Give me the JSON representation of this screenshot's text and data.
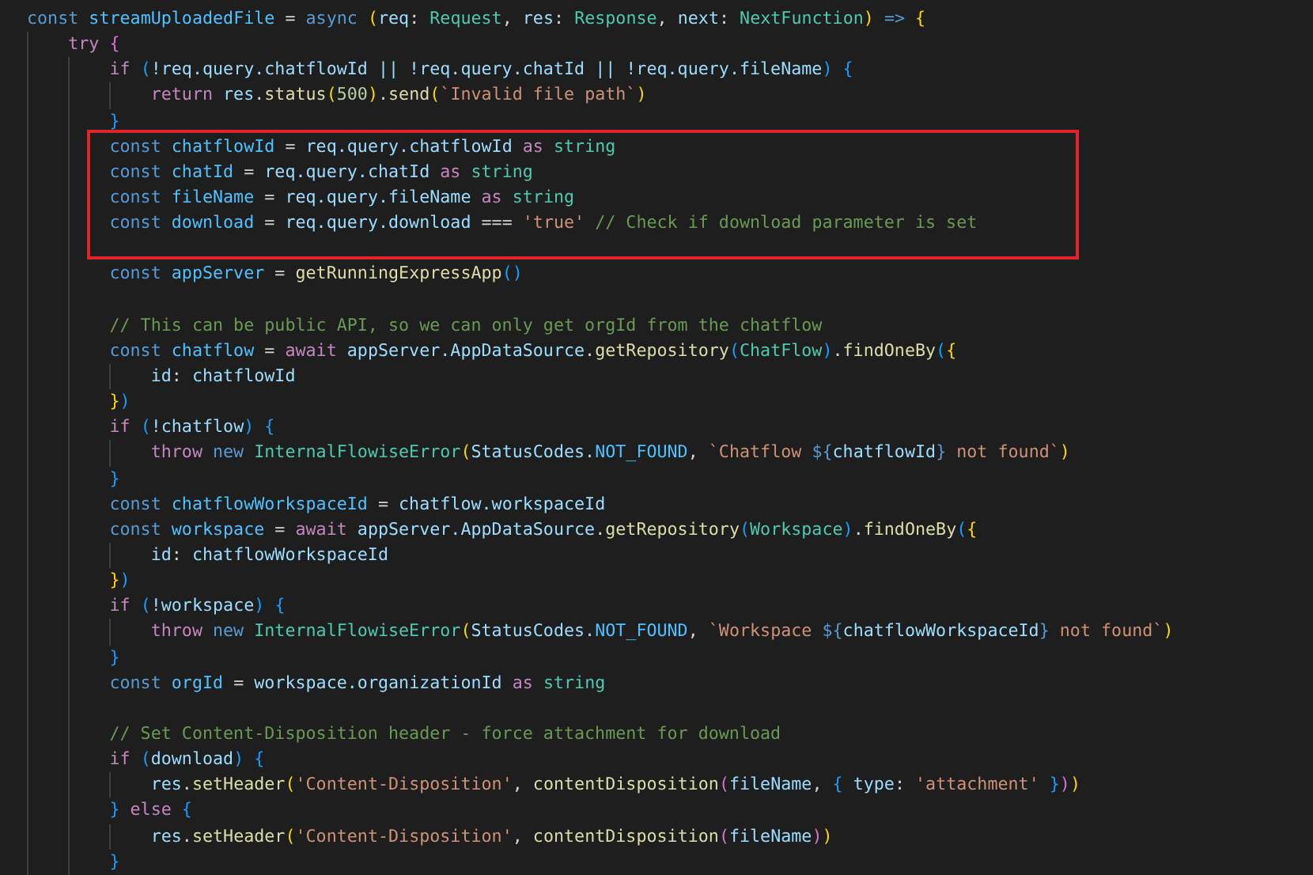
{
  "editor": {
    "lines": [
      {
        "kind": "code",
        "tokens": [
          {
            "text": "const ",
            "kind": "keyword"
          },
          {
            "text": "streamUploadedFile",
            "kind": "constant"
          },
          {
            "text": " = ",
            "kind": "plain"
          },
          {
            "text": "async ",
            "kind": "keyword"
          },
          {
            "text": "(",
            "kind": "bracket1"
          },
          {
            "text": "req",
            "kind": "variable"
          },
          {
            "text": ": ",
            "kind": "plain"
          },
          {
            "text": "Request",
            "kind": "type"
          },
          {
            "text": ", ",
            "kind": "plain"
          },
          {
            "text": "res",
            "kind": "variable"
          },
          {
            "text": ": ",
            "kind": "plain"
          },
          {
            "text": "Response",
            "kind": "type"
          },
          {
            "text": ", ",
            "kind": "plain"
          },
          {
            "text": "next",
            "kind": "variable"
          },
          {
            "text": ": ",
            "kind": "plain"
          },
          {
            "text": "NextFunction",
            "kind": "type"
          },
          {
            "text": ")",
            "kind": "bracket1"
          },
          {
            "text": " => ",
            "kind": "keyword"
          },
          {
            "text": "{",
            "kind": "bracket1"
          }
        ],
        "children": [
          {
            "kind": "code",
            "tokens": [
              {
                "text": "try ",
                "kind": "control"
              },
              {
                "text": "{",
                "kind": "bracket2"
              }
            ],
            "children": [
              {
                "kind": "code",
                "tokens": [
                  {
                    "text": "if ",
                    "kind": "control"
                  },
                  {
                    "text": "(",
                    "kind": "bracket3"
                  },
                  {
                    "text": "!req.query.chatflowId || !req.query.chatId || !req.query.fileName",
                    "kind": "variable"
                  },
                  {
                    "text": ") {",
                    "kind": "bracket3"
                  }
                ],
                "children": [
                  {
                    "kind": "code",
                    "tokens": [
                      {
                        "text": "return ",
                        "kind": "control"
                      },
                      {
                        "text": "res",
                        "kind": "variable"
                      },
                      {
                        "text": ".",
                        "kind": "plain"
                      },
                      {
                        "text": "status",
                        "kind": "function"
                      },
                      {
                        "text": "(",
                        "kind": "bracket1"
                      },
                      {
                        "text": "500",
                        "kind": "number"
                      },
                      {
                        "text": ")",
                        "kind": "bracket1"
                      },
                      {
                        "text": ".",
                        "kind": "plain"
                      },
                      {
                        "text": "send",
                        "kind": "function"
                      },
                      {
                        "text": "(",
                        "kind": "bracket1"
                      },
                      {
                        "text": "`Invalid file path`",
                        "kind": "string"
                      },
                      {
                        "text": ")",
                        "kind": "bracket1"
                      }
                    ]
                  }
                ]
              },
              {
                "kind": "code",
                "tokens": [
                  {
                    "text": "}",
                    "kind": "bracket3"
                  }
                ]
              },
              {
                "kind": "code",
                "tokens": [
                  {
                    "text": "const ",
                    "kind": "keyword"
                  },
                  {
                    "text": "chatflowId",
                    "kind": "constant"
                  },
                  {
                    "text": " = ",
                    "kind": "plain"
                  },
                  {
                    "text": "req.query.chatflowId",
                    "kind": "variable"
                  },
                  {
                    "text": " as ",
                    "kind": "control"
                  },
                  {
                    "text": "string",
                    "kind": "type"
                  }
                ]
              },
              {
                "kind": "code",
                "tokens": [
                  {
                    "text": "const ",
                    "kind": "keyword"
                  },
                  {
                    "text": "chatId",
                    "kind": "constant"
                  },
                  {
                    "text": " = ",
                    "kind": "plain"
                  },
                  {
                    "text": "req.query.chatId",
                    "kind": "variable"
                  },
                  {
                    "text": " as ",
                    "kind": "control"
                  },
                  {
                    "text": "string",
                    "kind": "type"
                  }
                ]
              },
              {
                "kind": "code",
                "tokens": [
                  {
                    "text": "const ",
                    "kind": "keyword"
                  },
                  {
                    "text": "fileName",
                    "kind": "constant"
                  },
                  {
                    "text": " = ",
                    "kind": "plain"
                  },
                  {
                    "text": "req.query.fileName",
                    "kind": "variable"
                  },
                  {
                    "text": " as ",
                    "kind": "control"
                  },
                  {
                    "text": "string",
                    "kind": "type"
                  }
                ]
              },
              {
                "kind": "code",
                "tokens": [
                  {
                    "text": "const ",
                    "kind": "keyword"
                  },
                  {
                    "text": "download",
                    "kind": "constant"
                  },
                  {
                    "text": " = ",
                    "kind": "plain"
                  },
                  {
                    "text": "req.query.download",
                    "kind": "variable"
                  },
                  {
                    "text": " === ",
                    "kind": "plain"
                  },
                  {
                    "text": "'true' ",
                    "kind": "string"
                  },
                  {
                    "text": "// Check if download parameter is set",
                    "kind": "comment"
                  }
                ]
              },
              {
                "kind": "blank"
              },
              {
                "kind": "code",
                "tokens": [
                  {
                    "text": "const ",
                    "kind": "keyword"
                  },
                  {
                    "text": "appServer",
                    "kind": "constant"
                  },
                  {
                    "text": " = ",
                    "kind": "plain"
                  },
                  {
                    "text": "getRunningExpressApp",
                    "kind": "function"
                  },
                  {
                    "text": "()",
                    "kind": "bracket3"
                  }
                ]
              },
              {
                "kind": "blank"
              },
              {
                "kind": "code",
                "tokens": [
                  {
                    "text": "// This can be public API, so we can only get orgId from the chatflow",
                    "kind": "comment"
                  }
                ]
              },
              {
                "kind": "code",
                "tokens": [
                  {
                    "text": "const ",
                    "kind": "keyword"
                  },
                  {
                    "text": "chatflow",
                    "kind": "constant"
                  },
                  {
                    "text": " = ",
                    "kind": "plain"
                  },
                  {
                    "text": "await ",
                    "kind": "control"
                  },
                  {
                    "text": "appServer.AppDataSource",
                    "kind": "variable"
                  },
                  {
                    "text": ".",
                    "kind": "plain"
                  },
                  {
                    "text": "getRepository",
                    "kind": "function"
                  },
                  {
                    "text": "(",
                    "kind": "bracket3"
                  },
                  {
                    "text": "ChatFlow",
                    "kind": "type"
                  },
                  {
                    "text": ")",
                    "kind": "bracket3"
                  },
                  {
                    "text": ".",
                    "kind": "plain"
                  },
                  {
                    "text": "findOneBy",
                    "kind": "function"
                  },
                  {
                    "text": "(",
                    "kind": "bracket3"
                  },
                  {
                    "text": "{",
                    "kind": "bracket1"
                  }
                ],
                "children": [
                  {
                    "kind": "code",
                    "tokens": [
                      {
                        "text": "id",
                        "kind": "variable"
                      },
                      {
                        "text": ": ",
                        "kind": "plain"
                      },
                      {
                        "text": "chatflowId",
                        "kind": "variable"
                      }
                    ]
                  }
                ]
              },
              {
                "kind": "code",
                "tokens": [
                  {
                    "text": "}",
                    "kind": "bracket1"
                  },
                  {
                    "text": ")",
                    "kind": "bracket3"
                  }
                ]
              },
              {
                "kind": "code",
                "tokens": [
                  {
                    "text": "if ",
                    "kind": "control"
                  },
                  {
                    "text": "(",
                    "kind": "bracket3"
                  },
                  {
                    "text": "!chatflow",
                    "kind": "variable"
                  },
                  {
                    "text": ") {",
                    "kind": "bracket3"
                  }
                ],
                "children": [
                  {
                    "kind": "code",
                    "tokens": [
                      {
                        "text": "throw ",
                        "kind": "control"
                      },
                      {
                        "text": "new ",
                        "kind": "keyword"
                      },
                      {
                        "text": "InternalFlowiseError",
                        "kind": "type"
                      },
                      {
                        "text": "(",
                        "kind": "bracket1"
                      },
                      {
                        "text": "StatusCodes.",
                        "kind": "variable"
                      },
                      {
                        "text": "NOT_FOUND",
                        "kind": "constant"
                      },
                      {
                        "text": ", ",
                        "kind": "plain"
                      },
                      {
                        "text": "`Chatflow ",
                        "kind": "string"
                      },
                      {
                        "text": "${",
                        "kind": "keyword"
                      },
                      {
                        "text": "chatflowId",
                        "kind": "variable"
                      },
                      {
                        "text": "}",
                        "kind": "keyword"
                      },
                      {
                        "text": " not found`",
                        "kind": "string"
                      },
                      {
                        "text": ")",
                        "kind": "bracket1"
                      }
                    ]
                  }
                ]
              },
              {
                "kind": "code",
                "tokens": [
                  {
                    "text": "}",
                    "kind": "bracket3"
                  }
                ]
              },
              {
                "kind": "code",
                "tokens": [
                  {
                    "text": "const ",
                    "kind": "keyword"
                  },
                  {
                    "text": "chatflowWorkspaceId",
                    "kind": "constant"
                  },
                  {
                    "text": " = ",
                    "kind": "plain"
                  },
                  {
                    "text": "chatflow.workspaceId",
                    "kind": "variable"
                  }
                ]
              },
              {
                "kind": "code",
                "tokens": [
                  {
                    "text": "const ",
                    "kind": "keyword"
                  },
                  {
                    "text": "workspace",
                    "kind": "constant"
                  },
                  {
                    "text": " = ",
                    "kind": "plain"
                  },
                  {
                    "text": "await ",
                    "kind": "control"
                  },
                  {
                    "text": "appServer.AppDataSource",
                    "kind": "variable"
                  },
                  {
                    "text": ".",
                    "kind": "plain"
                  },
                  {
                    "text": "getRepository",
                    "kind": "function"
                  },
                  {
                    "text": "(",
                    "kind": "bracket3"
                  },
                  {
                    "text": "Workspace",
                    "kind": "type"
                  },
                  {
                    "text": ")",
                    "kind": "bracket3"
                  },
                  {
                    "text": ".",
                    "kind": "plain"
                  },
                  {
                    "text": "findOneBy",
                    "kind": "function"
                  },
                  {
                    "text": "(",
                    "kind": "bracket3"
                  },
                  {
                    "text": "{",
                    "kind": "bracket1"
                  }
                ],
                "children": [
                  {
                    "kind": "code",
                    "tokens": [
                      {
                        "text": "id",
                        "kind": "variable"
                      },
                      {
                        "text": ": ",
                        "kind": "plain"
                      },
                      {
                        "text": "chatflowWorkspaceId",
                        "kind": "variable"
                      }
                    ]
                  }
                ]
              },
              {
                "kind": "code",
                "tokens": [
                  {
                    "text": "}",
                    "kind": "bracket1"
                  },
                  {
                    "text": ")",
                    "kind": "bracket3"
                  }
                ]
              },
              {
                "kind": "code",
                "tokens": [
                  {
                    "text": "if ",
                    "kind": "control"
                  },
                  {
                    "text": "(",
                    "kind": "bracket3"
                  },
                  {
                    "text": "!workspace",
                    "kind": "variable"
                  },
                  {
                    "text": ") {",
                    "kind": "bracket3"
                  }
                ],
                "children": [
                  {
                    "kind": "code",
                    "tokens": [
                      {
                        "text": "throw ",
                        "kind": "control"
                      },
                      {
                        "text": "new ",
                        "kind": "keyword"
                      },
                      {
                        "text": "InternalFlowiseError",
                        "kind": "type"
                      },
                      {
                        "text": "(",
                        "kind": "bracket1"
                      },
                      {
                        "text": "StatusCodes.",
                        "kind": "variable"
                      },
                      {
                        "text": "NOT_FOUND",
                        "kind": "constant"
                      },
                      {
                        "text": ", ",
                        "kind": "plain"
                      },
                      {
                        "text": "`Workspace ",
                        "kind": "string"
                      },
                      {
                        "text": "${",
                        "kind": "keyword"
                      },
                      {
                        "text": "chatflowWorkspaceId",
                        "kind": "variable"
                      },
                      {
                        "text": "}",
                        "kind": "keyword"
                      },
                      {
                        "text": " not found`",
                        "kind": "string"
                      },
                      {
                        "text": ")",
                        "kind": "bracket1"
                      }
                    ]
                  }
                ]
              },
              {
                "kind": "code",
                "tokens": [
                  {
                    "text": "}",
                    "kind": "bracket3"
                  }
                ]
              },
              {
                "kind": "code",
                "tokens": [
                  {
                    "text": "const ",
                    "kind": "keyword"
                  },
                  {
                    "text": "orgId",
                    "kind": "constant"
                  },
                  {
                    "text": " = ",
                    "kind": "plain"
                  },
                  {
                    "text": "workspace.organizationId",
                    "kind": "variable"
                  },
                  {
                    "text": " as ",
                    "kind": "control"
                  },
                  {
                    "text": "string",
                    "kind": "type"
                  }
                ]
              },
              {
                "kind": "blank"
              },
              {
                "kind": "code",
                "tokens": [
                  {
                    "text": "// Set Content-Disposition header - force attachment for download",
                    "kind": "comment"
                  }
                ]
              },
              {
                "kind": "code",
                "tokens": [
                  {
                    "text": "if ",
                    "kind": "control"
                  },
                  {
                    "text": "(",
                    "kind": "bracket3"
                  },
                  {
                    "text": "download",
                    "kind": "variable"
                  },
                  {
                    "text": ") {",
                    "kind": "bracket3"
                  }
                ],
                "children": [
                  {
                    "kind": "code",
                    "tokens": [
                      {
                        "text": "res",
                        "kind": "variable"
                      },
                      {
                        "text": ".",
                        "kind": "plain"
                      },
                      {
                        "text": "setHeader",
                        "kind": "function"
                      },
                      {
                        "text": "(",
                        "kind": "bracket1"
                      },
                      {
                        "text": "'Content-Disposition'",
                        "kind": "string"
                      },
                      {
                        "text": ", ",
                        "kind": "plain"
                      },
                      {
                        "text": "contentDisposition",
                        "kind": "function"
                      },
                      {
                        "text": "(",
                        "kind": "bracket2"
                      },
                      {
                        "text": "fileName",
                        "kind": "variable"
                      },
                      {
                        "text": ", ",
                        "kind": "plain"
                      },
                      {
                        "text": "{",
                        "kind": "bracket3"
                      },
                      {
                        "text": " type",
                        "kind": "variable"
                      },
                      {
                        "text": ": ",
                        "kind": "plain"
                      },
                      {
                        "text": "'attachment'",
                        "kind": "string"
                      },
                      {
                        "text": " }",
                        "kind": "bracket3"
                      },
                      {
                        "text": ")",
                        "kind": "bracket2"
                      },
                      {
                        "text": ")",
                        "kind": "bracket1"
                      }
                    ]
                  }
                ]
              },
              {
                "kind": "code",
                "tokens": [
                  {
                    "text": "}",
                    "kind": "bracket3"
                  },
                  {
                    "text": " else ",
                    "kind": "control"
                  },
                  {
                    "text": "{",
                    "kind": "bracket3"
                  }
                ],
                "children": [
                  {
                    "kind": "code",
                    "tokens": [
                      {
                        "text": "res",
                        "kind": "variable"
                      },
                      {
                        "text": ".",
                        "kind": "plain"
                      },
                      {
                        "text": "setHeader",
                        "kind": "function"
                      },
                      {
                        "text": "(",
                        "kind": "bracket1"
                      },
                      {
                        "text": "'Content-Disposition'",
                        "kind": "string"
                      },
                      {
                        "text": ", ",
                        "kind": "plain"
                      },
                      {
                        "text": "contentDisposition",
                        "kind": "function"
                      },
                      {
                        "text": "(",
                        "kind": "bracket2"
                      },
                      {
                        "text": "fileName",
                        "kind": "variable"
                      },
                      {
                        "text": ")",
                        "kind": "bracket2"
                      },
                      {
                        "text": ")",
                        "kind": "bracket1"
                      }
                    ]
                  }
                ]
              },
              {
                "kind": "code",
                "tokens": [
                  {
                    "text": "}",
                    "kind": "bracket3"
                  }
                ]
              }
            ]
          }
        ]
      }
    ]
  }
}
